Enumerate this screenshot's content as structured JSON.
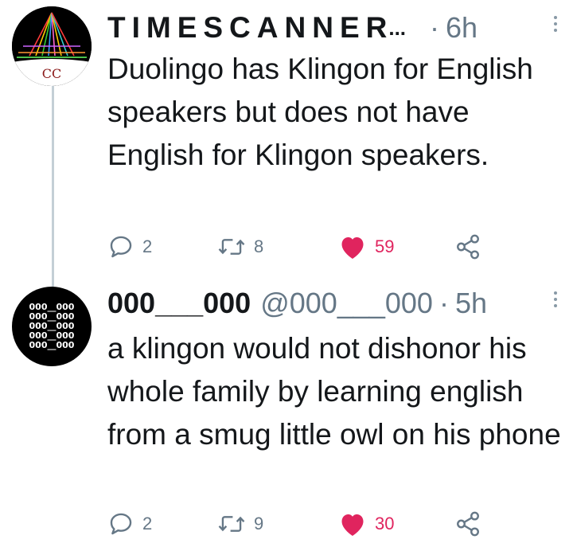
{
  "tweets": [
    {
      "display_name": "TIMESCANNER",
      "ellipsis": "...",
      "dot": "·",
      "time": "6h",
      "text": "Duolingo has Klingon for English speakers but does not have English for Klingon speakers.",
      "avatar_monogram": "CC",
      "replies": "2",
      "retweets": "8",
      "likes": "59",
      "liked": true
    },
    {
      "display_name": "000___000",
      "handle": "@000___000",
      "dot": "·",
      "time": "5h",
      "text": "a klingon would not dishonor his whole family by learning english from a smug little owl on his phone",
      "avatar_rows": [
        "000__000",
        "000__000",
        "000__000",
        "000__000",
        "000__000"
      ],
      "replies": "2",
      "retweets": "9",
      "likes": "30",
      "liked": true
    }
  ],
  "colors": {
    "text": "#14171a",
    "secondary": "#657786",
    "like": "#e0245e",
    "thread_line": "#c4cfd6"
  },
  "icons": {
    "reply": "reply-icon",
    "retweet": "retweet-icon",
    "like": "heart-icon",
    "share": "share-icon",
    "more": "more-options-icon"
  }
}
